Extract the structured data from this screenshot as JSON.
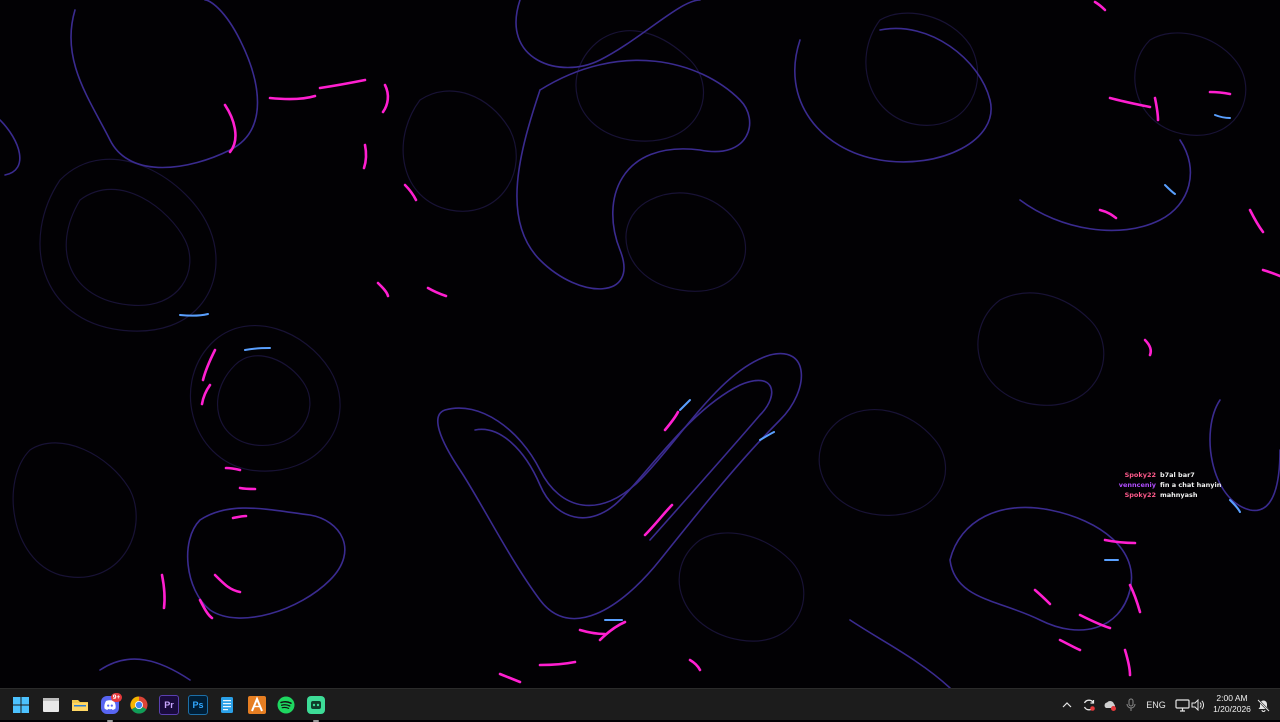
{
  "chat_overlay": {
    "messages": [
      {
        "user": "Spoky22",
        "text": "b7al bar7",
        "user_color": "#ff5a8c"
      },
      {
        "user": "vennceniy",
        "text": "fin a chat hanyin",
        "user_color": "#b14dff"
      },
      {
        "user": "Spoky22",
        "text": "mahnyash",
        "user_color": "#ff5a8c"
      }
    ]
  },
  "taskbar": {
    "pinned_apps": [
      {
        "name": "start-button",
        "icon": "windows-logo-icon"
      },
      {
        "name": "taskbar-file-window",
        "icon": "window-icon"
      },
      {
        "name": "taskbar-file-explorer",
        "icon": "folder-icon"
      },
      {
        "name": "taskbar-discord",
        "icon": "discord-icon",
        "badge": "9+"
      },
      {
        "name": "taskbar-chrome",
        "icon": "chrome-icon"
      },
      {
        "name": "taskbar-premiere",
        "icon": "premiere-pro-icon",
        "label": "Pr"
      },
      {
        "name": "taskbar-photoshop",
        "icon": "photoshop-icon",
        "label": "Ps"
      },
      {
        "name": "taskbar-notepad",
        "icon": "notepad-icon"
      },
      {
        "name": "taskbar-app-a",
        "icon": "a-app-icon"
      },
      {
        "name": "taskbar-spotify",
        "icon": "spotify-icon"
      },
      {
        "name": "taskbar-green-app",
        "icon": "green-robot-icon"
      }
    ],
    "tray": {
      "language": "ENG",
      "time": "2:00 AM",
      "date": "1/20/2026"
    }
  },
  "colors": {
    "background": "#020104",
    "taskbar": "#1c1c1c",
    "contour_line": "#3a2a8a",
    "accent_magenta": "#ff1fd0",
    "accent_blue": "#5aa0ff"
  }
}
